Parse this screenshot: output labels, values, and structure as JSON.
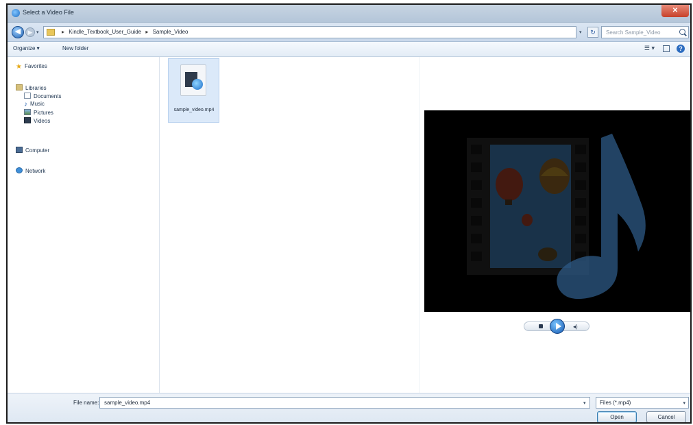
{
  "window": {
    "title": "Select a Video File",
    "close_label": "✕"
  },
  "address": {
    "crumbs": [
      "Kindle_Textbook_User_Guide",
      "Sample_Video"
    ],
    "separator": "▸",
    "search_placeholder": "Search Sample_Video"
  },
  "toolbar": {
    "organize_label": "Organize ▾",
    "new_folder_label": "New folder",
    "views_label": "☰ ▾"
  },
  "nav": {
    "favorites": "Favorites",
    "libraries": "Libraries",
    "documents": "Documents",
    "music": "Music",
    "pictures": "Pictures",
    "videos": "Videos",
    "computer": "Computer",
    "network": "Network"
  },
  "files": [
    {
      "name": "sample_video.mp4"
    }
  ],
  "bottom": {
    "file_name_label": "File name:",
    "file_name_value": "sample_video.mp4",
    "filter_value": "Files (*.mp4)",
    "open_label": "Open",
    "cancel_label": "Cancel"
  },
  "colors": {
    "accent": "#2c6cc0",
    "video_bg": "#000000",
    "selection": "#dbe9f9"
  },
  "icons": [
    "back-arrow-icon",
    "forward-arrow-icon",
    "folder-icon",
    "refresh-icon",
    "search-icon",
    "help-icon",
    "star-icon",
    "library-icon",
    "document-icon",
    "music-icon",
    "pictures-icon",
    "videos-icon",
    "computer-icon",
    "network-icon",
    "video-file-icon",
    "play-icon",
    "stop-icon",
    "volume-icon"
  ]
}
